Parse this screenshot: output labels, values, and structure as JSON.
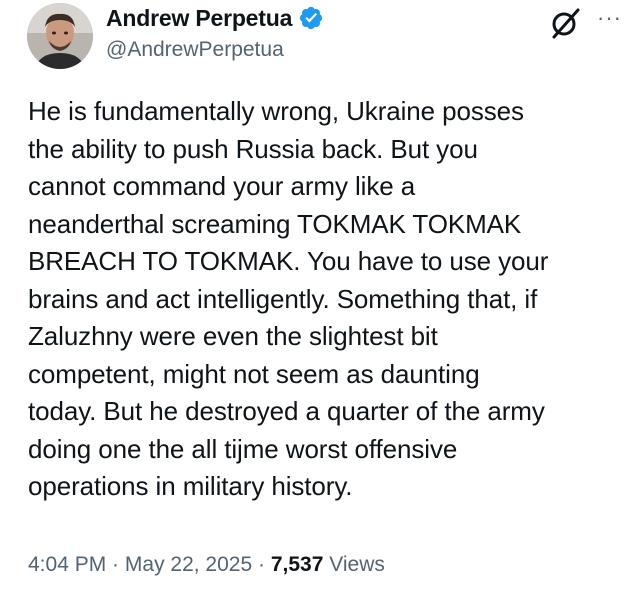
{
  "author": {
    "display_name": "Andrew Perpetua",
    "handle": "@AndrewPerpetua",
    "verified_icon": "verified-badge-icon",
    "avatar_icon": "avatar"
  },
  "actions": {
    "grok_icon": "grok-icon",
    "more_label": "···"
  },
  "tweet": {
    "text": "He is fundamentally wrong, Ukraine posses\nthe ability to push Russia back. But you\ncannot command your army like a\nneanderthal screaming TOKMAK TOKMAK\nBREACH TO TOKMAK. You have to use your\nbrains and act intelligently. Something that, if\nZaluzhny were even the slightest bit\ncompetent, might not seem as daunting\ntoday. But he destroyed a quarter of the army\ndoing one the all tijme worst offensive\noperations in military history."
  },
  "meta": {
    "time": "4:04 PM",
    "separator": " · ",
    "date": "May 22, 2025",
    "separator2": " · ",
    "views_count": "7,537",
    "views_label": " Views"
  },
  "colors": {
    "text": "#0f1419",
    "secondary": "#536471",
    "verified": "#1d9bf0"
  }
}
